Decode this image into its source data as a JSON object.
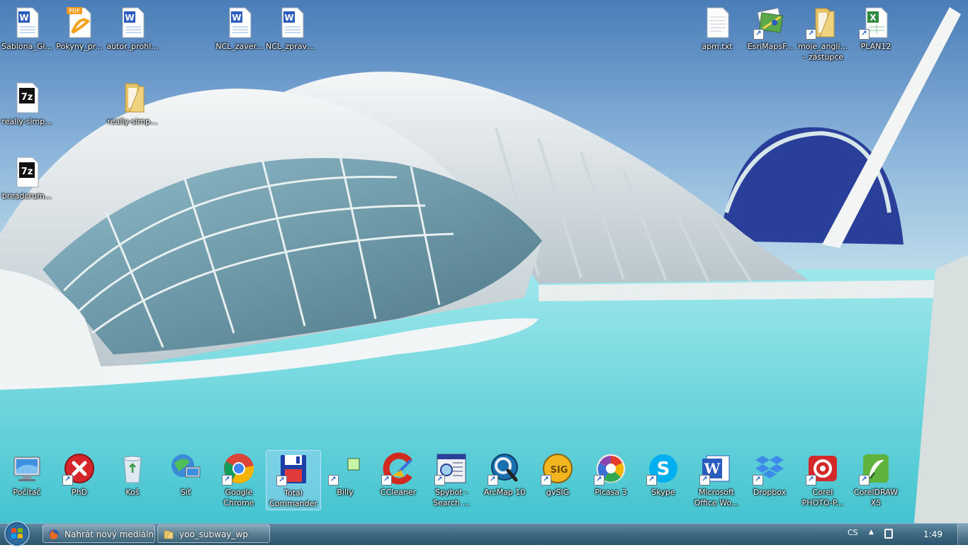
{
  "desktop_icons": [
    {
      "label": "Sablona_Gl...",
      "icon": "word-document-icon"
    },
    {
      "label": "Pokyny_pr...",
      "icon": "pdf-document-icon"
    },
    {
      "label": "autor_prohl...",
      "icon": "word-document-icon"
    },
    {
      "label": "NCL_zaver...",
      "icon": "word-document-icon"
    },
    {
      "label": "NCL_zprava...",
      "icon": "word-document-icon"
    },
    {
      "label": "apm.txt",
      "icon": "text-file-icon"
    },
    {
      "label": "EsriMapsF...",
      "icon": "esri-maps-icon"
    },
    {
      "label": "moje_angli... – zástupce",
      "icon": "folder-icon"
    },
    {
      "label": "PLAN12",
      "icon": "excel-document-icon"
    },
    {
      "label": "really-simp...",
      "icon": "7zip-archive-icon"
    },
    {
      "label": "really-simp...",
      "icon": "folder-icon"
    },
    {
      "label": "breadcrum...",
      "icon": "7zip-archive-icon"
    }
  ],
  "dock_icons": [
    {
      "label": "Počítač",
      "icon": "computer-icon"
    },
    {
      "label": "PhD",
      "icon": "phd-icon"
    },
    {
      "label": "Koš",
      "icon": "recycle-bin-icon"
    },
    {
      "label": "Síť",
      "icon": "network-icon"
    },
    {
      "label": "Google Chrome",
      "icon": "chrome-icon"
    },
    {
      "label": "Total Commander",
      "icon": "total-commander-icon"
    },
    {
      "label": "Billy",
      "icon": "billy-icon"
    },
    {
      "label": "CCleaner",
      "icon": "ccleaner-icon"
    },
    {
      "label": "Spybot - Search ...",
      "icon": "spybot-icon"
    },
    {
      "label": "ArcMap 10",
      "icon": "arcmap-icon"
    },
    {
      "label": "gvSIG",
      "icon": "gvsig-icon"
    },
    {
      "label": "Picasa 3",
      "icon": "picasa-icon"
    },
    {
      "label": "Skype",
      "icon": "skype-icon"
    },
    {
      "label": "Microsoft Office Wo...",
      "icon": "word-icon"
    },
    {
      "label": "Dropbox",
      "icon": "dropbox-icon"
    },
    {
      "label": "Corel PHOTO-P...",
      "icon": "corel-photo-paint-icon"
    },
    {
      "label": "CorelDRAW X5",
      "icon": "coreldraw-icon"
    }
  ],
  "taskbar": {
    "buttons": [
      {
        "label": "Nahrát nový mediáln...",
        "icon": "firefox-icon"
      },
      {
        "label": "yoo_subway_wp",
        "icon": "folder-icon"
      }
    ],
    "language": "CS",
    "clock": "1:49"
  },
  "colors": {
    "taskbar": "#3f6a82",
    "water": "#5fd3da",
    "sky": "#5b8cc2"
  }
}
